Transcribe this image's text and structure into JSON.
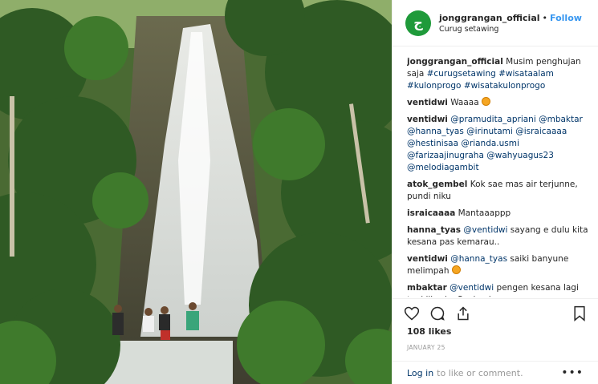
{
  "header": {
    "username": "jonggrangan_official",
    "dot": "•",
    "follow_label": "Follow",
    "location": "Curug setawing",
    "avatar_letter": "ج"
  },
  "caption": {
    "user": "jonggrangan_official",
    "text": "Musim penghujan saja",
    "tags": [
      "#curugsetawing",
      "#wisataalam",
      "#kulonprogo",
      "#wisatakulonprogo"
    ]
  },
  "comments": [
    {
      "user": "ventidwi",
      "text": "Waaaa",
      "emoji": true
    },
    {
      "user": "ventidwi",
      "mentions": [
        "@pramudita_apriani",
        "@mbaktar",
        "@hanna_tyas",
        "@irinutami",
        "@israicaaaa",
        "@hestinisaa",
        "@rianda.usmi",
        "@farizaajinugraha",
        "@wahyuagus23",
        "@melodiagambit"
      ]
    },
    {
      "user": "atok_gembel",
      "text": "Kok sae mas air terjunne, pundi niku"
    },
    {
      "user": "israicaaaa",
      "text": "Mantaaappp"
    },
    {
      "user": "hanna_tyas",
      "mention": "@ventidwi",
      "text": "sayang e dulu kita kesana pas kemarau.."
    },
    {
      "user": "ventidwi",
      "mention": "@hanna_tyas",
      "text": "saiki banyune melimpah",
      "emoji": true
    },
    {
      "user": "mbaktar",
      "mention": "@ventidwi",
      "text": "pengen kesana lagi tapi liburku Senin eh"
    }
  ],
  "likes": "108 likes",
  "date": "JANUARY 25",
  "footer": {
    "login_label": "Log in",
    "rest": "to like or comment.",
    "more": "•••"
  },
  "icons": [
    "heart-icon",
    "comment-icon",
    "share-icon",
    "bookmark-icon"
  ]
}
